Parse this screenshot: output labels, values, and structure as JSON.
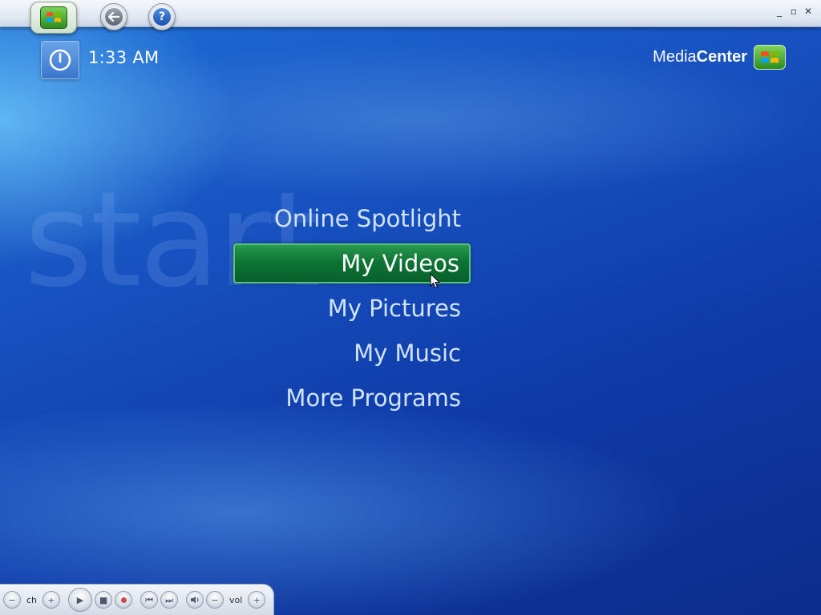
{
  "window": {
    "controls": [
      "minimize",
      "restore",
      "close"
    ],
    "control_glyphs": {
      "minimize": "_",
      "restore": "▫",
      "close": "✕"
    }
  },
  "topbar": {
    "start_icon": "windows-logo-icon",
    "back_icon": "back-arrow-icon",
    "help_icon": "help-icon",
    "back_glyph": "←",
    "help_glyph": "?"
  },
  "status": {
    "power_icon": "power-icon",
    "time": "1:33 AM"
  },
  "brand": {
    "text_regular": "Media",
    "text_bold": "Center",
    "logo_icon": "windows-logo-icon"
  },
  "watermark": "start",
  "menu": {
    "items": [
      {
        "label": "Online Spotlight",
        "selected": false
      },
      {
        "label": "My Videos",
        "selected": true
      },
      {
        "label": "My Pictures",
        "selected": false
      },
      {
        "label": "My Music",
        "selected": false
      },
      {
        "label": "More Programs",
        "selected": false
      }
    ]
  },
  "transport": {
    "ch_label": "ch",
    "vol_label": "vol",
    "buttons": [
      "channel-down",
      "channel-up",
      "play",
      "stop",
      "record",
      "skip-back",
      "skip-forward",
      "mute",
      "volume-down",
      "volume-up"
    ],
    "glyphs": {
      "channel_down": "−",
      "channel_up": "+",
      "play": "▶",
      "stop": "■",
      "skip_back": "⏮",
      "skip_forward": "⏭",
      "mute": "🔊",
      "volume_down": "−",
      "volume_up": "+"
    }
  },
  "colors": {
    "background_deep": "#0b2c8c",
    "background_mid": "#1752c0",
    "selected_green": "#0d7435",
    "menu_text": "#cfe3ff"
  }
}
